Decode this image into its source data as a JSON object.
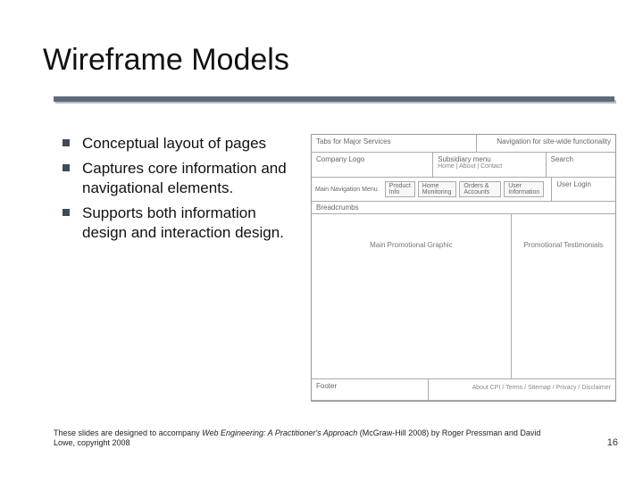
{
  "title": "Wireframe Models",
  "bullets": [
    "Conceptual layout of pages",
    "Captures core information and navigational elements.",
    "Supports both information design and interaction design."
  ],
  "wireframe": {
    "top_left": "Tabs for Major Services",
    "top_right": "Navigation for site-wide functionality",
    "logo": "Company Logo",
    "sub_menu_label": "Subsidiary menu",
    "sub_menu_items": "Home | About | Contact",
    "search": "Search",
    "nav_label": "Main Navigation Menu",
    "nav_tabs": [
      "Product Info",
      "Home Monitoring",
      "Orders & Accounts",
      "User Information"
    ],
    "user_login": "User Login",
    "breadcrumbs": "Breadcrumbs",
    "main_graphic": "Main Promotional Graphic",
    "testimonials": "Promotional Testimonials",
    "footer": "Footer",
    "footer_links": "About CPI / Terms / Sitemap / Privacy / Disclaimer"
  },
  "attribution": {
    "prefix": "These slides are designed to accompany ",
    "book": "Web Engineering: A Practitioner's Approach",
    "suffix": " (McGraw-Hill 2008) by Roger Pressman and David Lowe, copyright 2008"
  },
  "page_number": "16"
}
